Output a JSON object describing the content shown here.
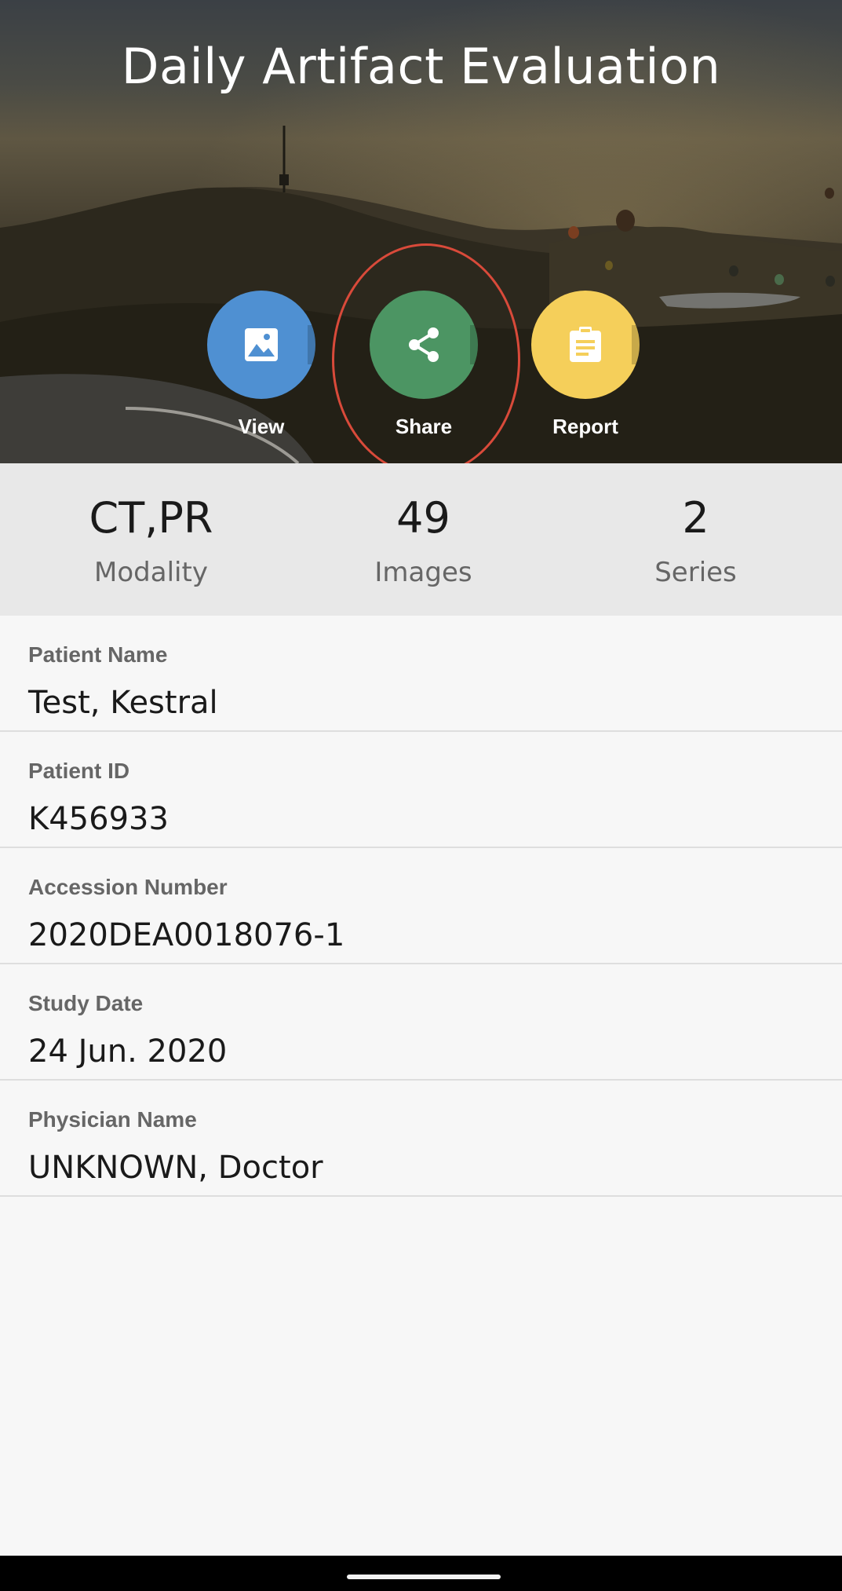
{
  "header": {
    "title": "Daily Artifact Evaluation"
  },
  "actions": [
    {
      "label": "View",
      "icon": "image-icon",
      "color": "#4f90d2"
    },
    {
      "label": "Share",
      "icon": "share-icon",
      "color": "#4c9563"
    },
    {
      "label": "Report",
      "icon": "clipboard-icon",
      "color": "#f5cf5a"
    }
  ],
  "stats": [
    {
      "value": "CT,PR",
      "caption": "Modality"
    },
    {
      "value": "49",
      "caption": "Images"
    },
    {
      "value": "2",
      "caption": "Series"
    }
  ],
  "details": [
    {
      "label": "Patient Name",
      "value": "Test, Kestral"
    },
    {
      "label": "Patient ID",
      "value": "K456933"
    },
    {
      "label": "Accession Number",
      "value": "2020DEA0018076-1"
    },
    {
      "label": "Study Date",
      "value": "24 Jun. 2020"
    },
    {
      "label": "Physician Name",
      "value": "UNKNOWN, Doctor"
    }
  ],
  "highlight_color": "#d94a3a"
}
